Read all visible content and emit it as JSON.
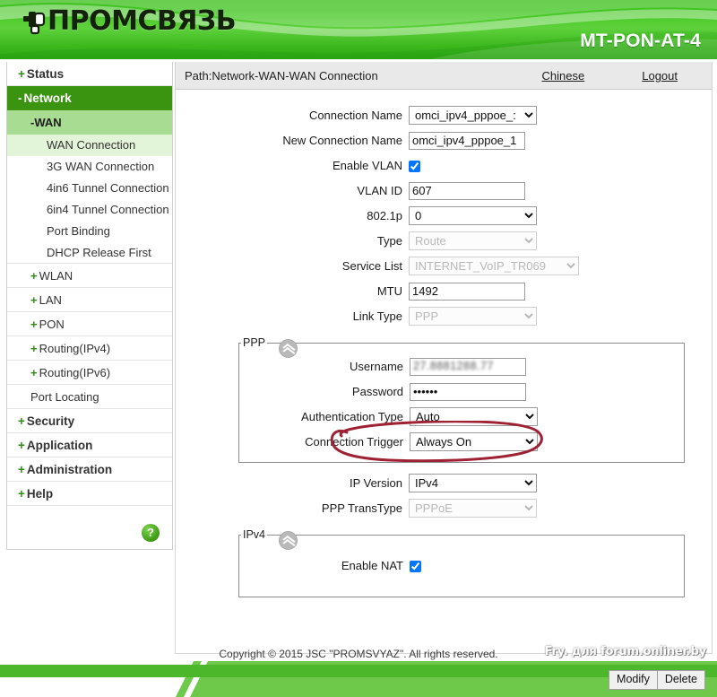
{
  "header": {
    "brand": "ПРОМСВЯЗЬ",
    "brand_icon": "plug-icon",
    "model": "MT-PON-AT-4"
  },
  "sidebar": {
    "items": [
      {
        "label": "Status",
        "marker": "+",
        "level": 0,
        "state": "normal"
      },
      {
        "label": "Network",
        "marker": "-",
        "level": 0,
        "state": "active"
      },
      {
        "label": "WAN",
        "marker": "-",
        "level": 1,
        "state": "active-light"
      },
      {
        "label": "WAN Connection",
        "marker": "",
        "level": 2,
        "state": "selected"
      },
      {
        "label": "3G WAN Connection",
        "marker": "",
        "level": 2,
        "state": "normal"
      },
      {
        "label": "4in6 Tunnel Connection",
        "marker": "",
        "level": 2,
        "state": "normal"
      },
      {
        "label": "6in4 Tunnel Connection",
        "marker": "",
        "level": 2,
        "state": "normal"
      },
      {
        "label": "Port Binding",
        "marker": "",
        "level": 2,
        "state": "normal"
      },
      {
        "label": "DHCP Release First",
        "marker": "",
        "level": 2,
        "state": "normal"
      },
      {
        "label": "WLAN",
        "marker": "+",
        "level": 1,
        "state": "normal"
      },
      {
        "label": "LAN",
        "marker": "+",
        "level": 1,
        "state": "normal"
      },
      {
        "label": "PON",
        "marker": "+",
        "level": 1,
        "state": "normal"
      },
      {
        "label": "Routing(IPv4)",
        "marker": "+",
        "level": 1,
        "state": "normal"
      },
      {
        "label": "Routing(IPv6)",
        "marker": "+",
        "level": 1,
        "state": "normal"
      },
      {
        "label": "Port Locating",
        "marker": "",
        "level": 1,
        "state": "normal"
      },
      {
        "label": "Security",
        "marker": "+",
        "level": 0,
        "state": "normal"
      },
      {
        "label": "Application",
        "marker": "+",
        "level": 0,
        "state": "normal"
      },
      {
        "label": "Administration",
        "marker": "+",
        "level": 0,
        "state": "normal"
      },
      {
        "label": "Help",
        "marker": "+",
        "level": 0,
        "state": "normal"
      }
    ],
    "help_badge": "?"
  },
  "pathbar": {
    "path": "Path:Network-WAN-WAN Connection",
    "chinese_link": "Chinese",
    "logout_link": "Logout"
  },
  "form": {
    "connection_name": {
      "label": "Connection Name",
      "value": "omci_ipv4_pppoe_:"
    },
    "new_connection_name": {
      "label": "New Connection Name",
      "value": "omci_ipv4_pppoe_1"
    },
    "enable_vlan": {
      "label": "Enable VLAN",
      "checked": true
    },
    "vlan_id": {
      "label": "VLAN ID",
      "value": "607"
    },
    "dot1p": {
      "label": "802.1p",
      "value": "0"
    },
    "type": {
      "label": "Type",
      "value": "Route",
      "disabled": true
    },
    "service_list": {
      "label": "Service List",
      "value": "INTERNET_VoIP_TR069",
      "disabled": true
    },
    "mtu": {
      "label": "MTU",
      "value": "1492"
    },
    "link_type": {
      "label": "Link Type",
      "value": "PPP",
      "disabled": true
    },
    "ip_version": {
      "label": "IP Version",
      "value": "IPv4"
    },
    "ppp_transtype": {
      "label": "PPP TransType",
      "value": "PPPoE",
      "disabled": true
    }
  },
  "ppp_section": {
    "legend": "PPP",
    "collapse_icon": "chevron-double-up-icon",
    "username": {
      "label": "Username",
      "value": "27.8881288.77"
    },
    "password": {
      "label": "Password",
      "value": "••••••"
    },
    "authentication_type": {
      "label": "Authentication Type",
      "value": "Auto"
    },
    "connection_trigger": {
      "label": "Connection Trigger",
      "value": "Always On"
    }
  },
  "ipv4_section": {
    "legend": "IPv4",
    "collapse_icon": "chevron-double-up-icon",
    "enable_nat": {
      "label": "Enable NAT",
      "checked": true
    }
  },
  "actions": {
    "modify_label": "Modify",
    "delete_label": "Delete"
  },
  "footer": {
    "copyright": "Copyright © 2015 JSC \"PROMSVYAZ\". All rights reserved.",
    "watermark": "Fry. для forum.onliner.by"
  },
  "annotation": {
    "shape": "red-ellipse-highlight",
    "color": "#9e2233",
    "targets": "Password field"
  },
  "colors": {
    "header_green": "#43c623",
    "menu_active": "#3b9410",
    "menu_sub_active": "#a8dc92",
    "menu_selected": "#e3f5d8",
    "footer_green": "#6ec84a",
    "strip_green": "#4cb72a"
  }
}
